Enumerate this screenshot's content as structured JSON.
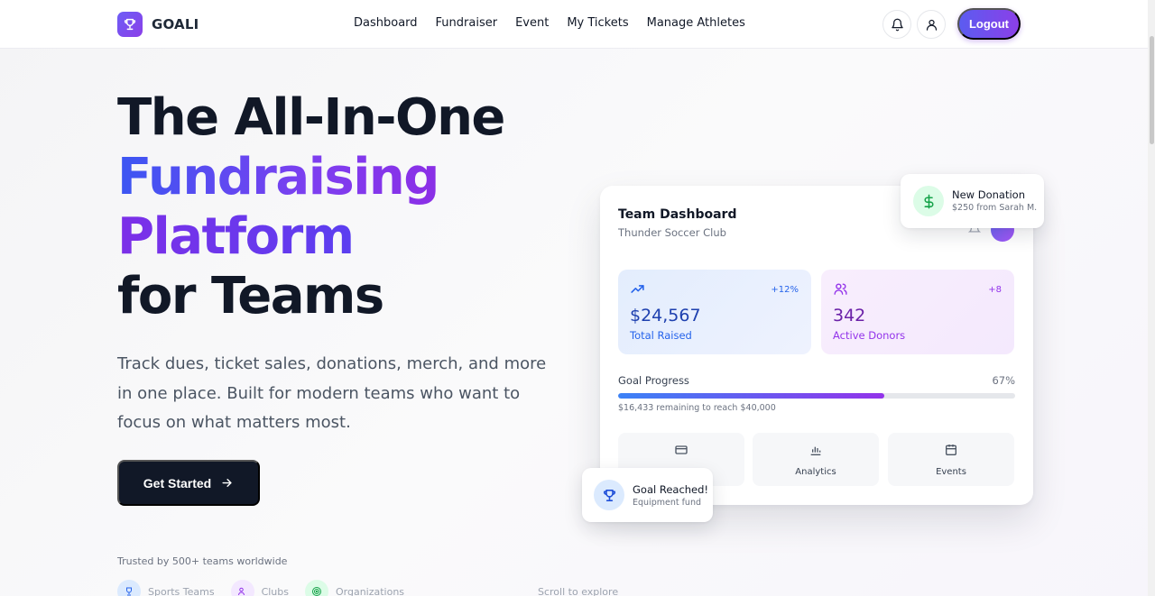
{
  "nav": {
    "brand": "GOALI",
    "links": [
      "Dashboard",
      "Fundraiser",
      "Event",
      "My Tickets",
      "Manage Athletes"
    ],
    "logout_label": "Logout",
    "icons": [
      "bell-icon",
      "user-icon"
    ]
  },
  "hero": {
    "title_line1": "The All-In-One",
    "title_line2": "Fundraising",
    "title_line3": "Platform",
    "title_line4": "for Teams",
    "subtitle": "Track dues, ticket sales, donations, merch, and more in one place. Built for modern teams who want to focus on what matters most.",
    "cta_label": "Get Started",
    "trusted_text": "Trusted by 500+ teams worldwide",
    "trust_items": [
      "Sports Teams",
      "Clubs",
      "Organizations"
    ],
    "scroll_hint": "Scroll to explore"
  },
  "dashboard": {
    "title": "Team Dashboard",
    "subtitle": "Thunder Soccer Club",
    "stats": [
      {
        "value": "$24,567",
        "label": "Total Raised",
        "delta": "+12%",
        "icon": "trending-up-icon"
      },
      {
        "value": "342",
        "label": "Active Donors",
        "delta": "+8",
        "icon": "users-icon"
      }
    ],
    "goal": {
      "label": "Goal Progress",
      "percent_text": "67%",
      "progress": 0.67,
      "remaining_text": "$16,433 remaining to reach $40,000"
    },
    "tiles": [
      {
        "label": "",
        "icon": "card-icon"
      },
      {
        "label": "Analytics",
        "icon": "bar-chart-icon"
      },
      {
        "label": "Events",
        "icon": "calendar-icon"
      }
    ]
  },
  "toasts": {
    "donation": {
      "title": "New Donation",
      "sub": "$250 from Sarah M."
    },
    "goal": {
      "title": "Goal Reached!",
      "sub": "Equipment fund"
    }
  },
  "colors": {
    "accent_start": "#5b5cf0",
    "accent_end": "#8b3fe8",
    "dark": "#111827"
  }
}
